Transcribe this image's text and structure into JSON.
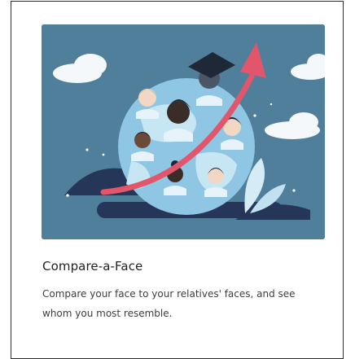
{
  "card": {
    "title": "Compare-a-Face",
    "description": "Compare your face to your relatives' faces, and see whom you most resemble."
  },
  "illustration": {
    "subject": "globe-with-faces-and-rising-arrow",
    "colors": {
      "background": "#4f7f9a",
      "globe": "#8fc6e3",
      "globe_land": "#c7e6f3",
      "arrow": "#e2566b",
      "cloud": "#f4f8fb",
      "dark_hill": "#253659",
      "leaf": "#d5ecf6"
    }
  }
}
